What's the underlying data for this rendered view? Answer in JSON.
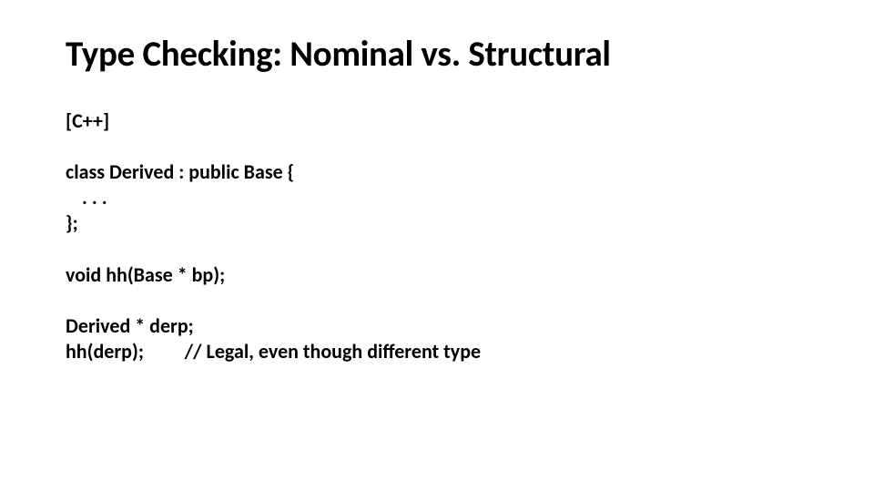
{
  "slide": {
    "title": "Type Checking: Nominal vs. Structural",
    "lang_label": "[C++]",
    "code": {
      "class_line": "class Derived : public Base {",
      "ellipsis": ". . .",
      "class_end": "};",
      "fn_decl": "void hh(Base * bp);",
      "var_decl": "Derived * derp;",
      "call_prefix": "hh(derp);         ",
      "comment": "// Legal, even though different type"
    }
  }
}
